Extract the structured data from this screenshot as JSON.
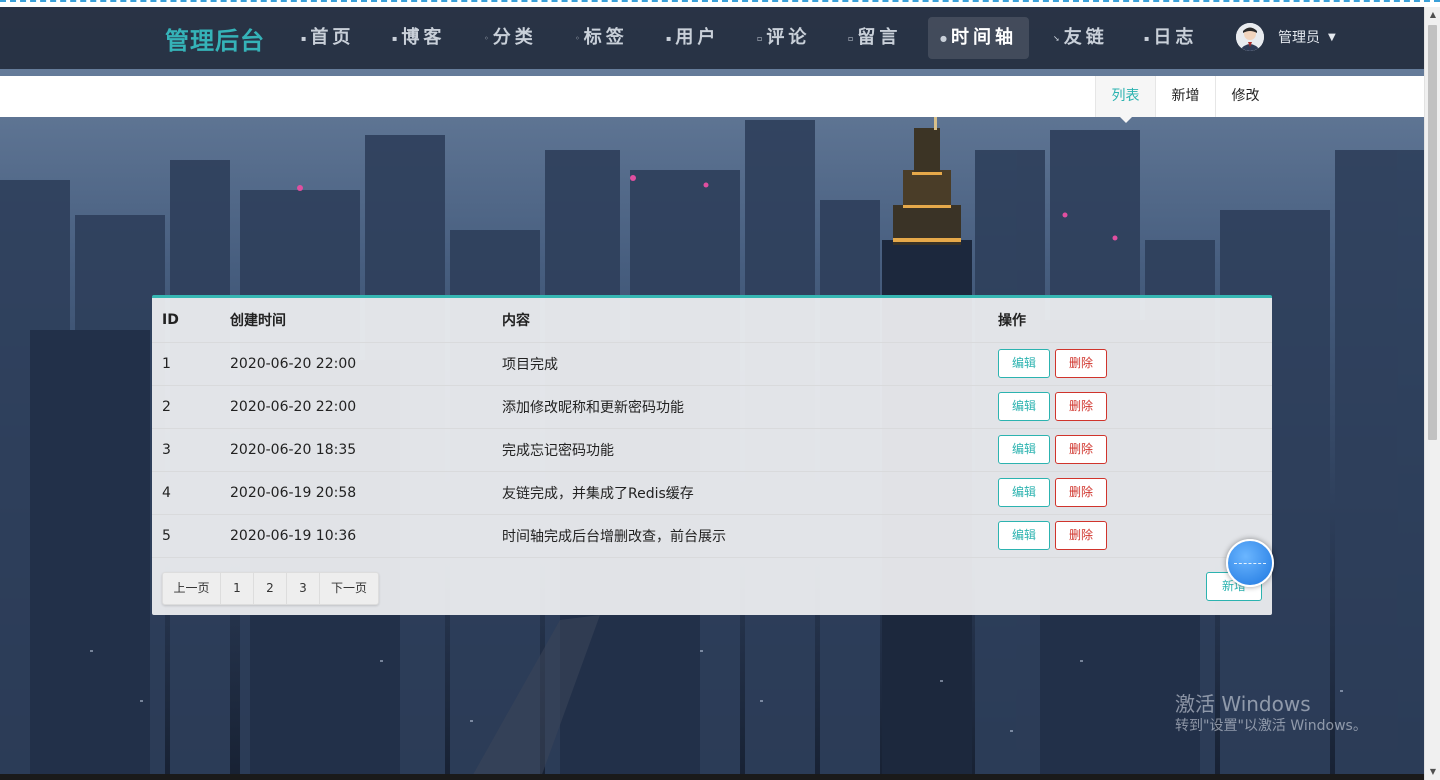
{
  "brand": "管理后台",
  "nav": {
    "items": [
      {
        "label": "首页",
        "icon": "home-icon",
        "glyph": "▪"
      },
      {
        "label": "博客",
        "icon": "blog-icon",
        "glyph": "▪"
      },
      {
        "label": "分类",
        "icon": "category-icon",
        "glyph": "◦"
      },
      {
        "label": "标签",
        "icon": "tag-icon",
        "glyph": "◦"
      },
      {
        "label": "用户",
        "icon": "user-icon",
        "glyph": "▪"
      },
      {
        "label": "评论",
        "icon": "comment-icon",
        "glyph": "▫"
      },
      {
        "label": "留言",
        "icon": "message-icon",
        "glyph": "▫"
      },
      {
        "label": "时间轴",
        "icon": "timeline-icon",
        "glyph": "●"
      },
      {
        "label": "友链",
        "icon": "link-icon",
        "glyph": "↘"
      },
      {
        "label": "日志",
        "icon": "log-icon",
        "glyph": "▪"
      }
    ],
    "active": "时间轴",
    "user_name": "管理员",
    "caret": "▼"
  },
  "submenu": {
    "list": "列表",
    "add": "新增",
    "edit": "修改"
  },
  "table": {
    "headers": [
      "ID",
      "创建时间",
      "内容",
      "操作"
    ],
    "rows": [
      {
        "id": "1",
        "time": "2020-06-20 22:00",
        "content": "项目完成"
      },
      {
        "id": "2",
        "time": "2020-06-20 22:00",
        "content": "添加修改昵称和更新密码功能"
      },
      {
        "id": "3",
        "time": "2020-06-20 18:35",
        "content": "完成忘记密码功能"
      },
      {
        "id": "4",
        "time": "2020-06-19 20:58",
        "content": "友链完成，并集成了Redis缓存"
      },
      {
        "id": "5",
        "time": "2020-06-19 10:36",
        "content": "时间轴完成后台增删改查，前台展示"
      }
    ],
    "edit_label": "编辑",
    "delete_label": "删除"
  },
  "pager": {
    "prev": "上一页",
    "pages": [
      "1",
      "2",
      "3"
    ],
    "next": "下一页"
  },
  "add_button": "新增",
  "watermark": {
    "line1": "激活 Windows",
    "line2": "转到\"设置\"以激活 Windows。"
  },
  "colors": {
    "accent": "#2cb3b0",
    "danger": "#d0342c",
    "nav_bg": "#242d3e"
  }
}
